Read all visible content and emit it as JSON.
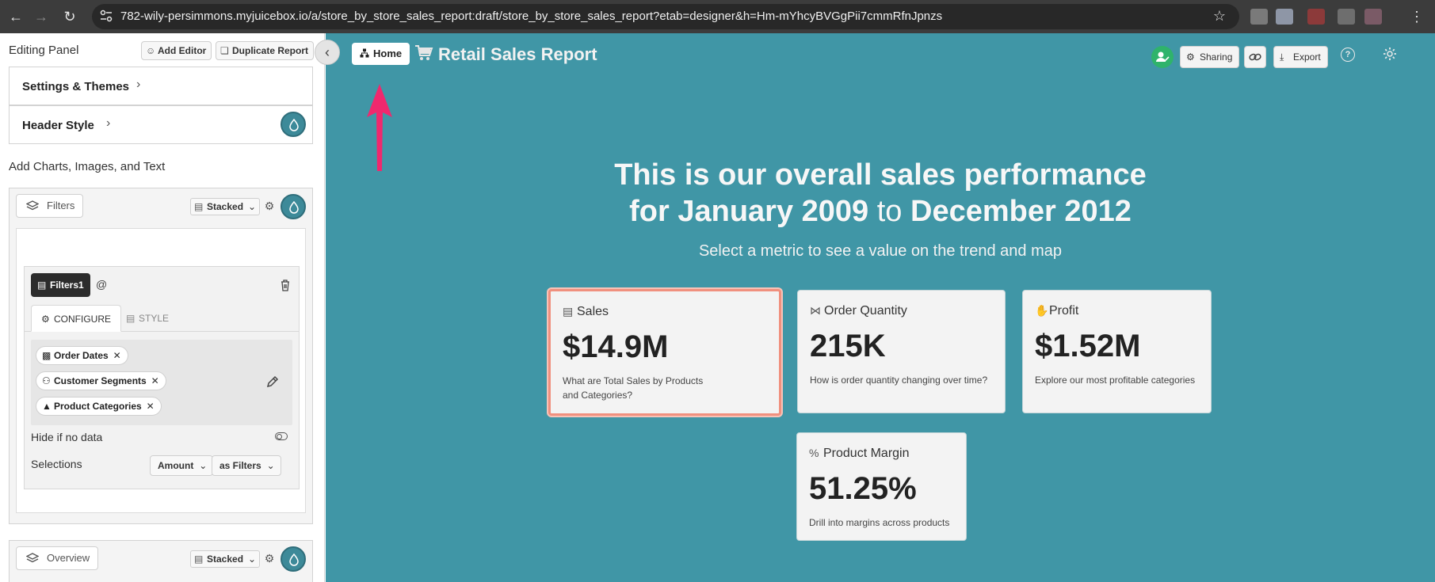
{
  "browser": {
    "url": "782-wily-persimmons.myjuicebox.io/a/store_by_store_sales_report:draft/store_by_store_sales_report?etab=designer&h=Hm-mYhcyBVGgPii7cmmRfnJpnzs"
  },
  "panel": {
    "title": "Editing Panel",
    "add_editor": "Add Editor",
    "duplicate_report": "Duplicate Report",
    "settings_themes": "Settings & Themes",
    "header_style": "Header Style",
    "add_label": "Add Charts, Images, and Text",
    "filters_card": {
      "layer_label": "Filters",
      "stacked_label": "Stacked",
      "tag_label": "Filters1",
      "tab_configure": "CONFIGURE",
      "tab_style": "STYLE",
      "chips": [
        "Order Dates",
        "Customer Segments",
        "Product Categories"
      ],
      "hide_if_no_data": "Hide if no data",
      "selections_label": "Selections",
      "amount_label": "Amount",
      "as_filters_label": "as Filters"
    },
    "overview_card": {
      "layer_label": "Overview",
      "stacked_label": "Stacked"
    }
  },
  "report": {
    "home_label": "Home",
    "title": "Retail Sales Report",
    "sharing_label": "Sharing",
    "export_label": "Export",
    "headline": {
      "line1": "This is our overall sales performance",
      "line2_a": "for January 2009",
      "line2_b": " to ",
      "line2_c": "December 2012"
    },
    "subheadline": "Select a metric to see a value on the trend and map",
    "metrics": [
      {
        "label": "Sales",
        "value": "$14.9M",
        "desc_line1": "What are Total Sales by Products",
        "desc_line2": "and Categories?",
        "selected": true
      },
      {
        "label": "Order Quantity",
        "value": "215K",
        "desc_line1": "How is order quantity changing over time?",
        "desc_line2": "",
        "selected": false
      },
      {
        "label": "Profit",
        "value": "$1.52M",
        "desc_line1": "Explore our most profitable categories",
        "desc_line2": "",
        "selected": false
      },
      {
        "label": "Product Margin",
        "value": "51.25%",
        "desc_line1": "Drill into margins across products",
        "desc_line2": "",
        "selected": false
      }
    ]
  },
  "colors": {
    "report_background": "#4096a6",
    "accent_selected_border": "#f0907e",
    "arrow": "#f0286e"
  }
}
